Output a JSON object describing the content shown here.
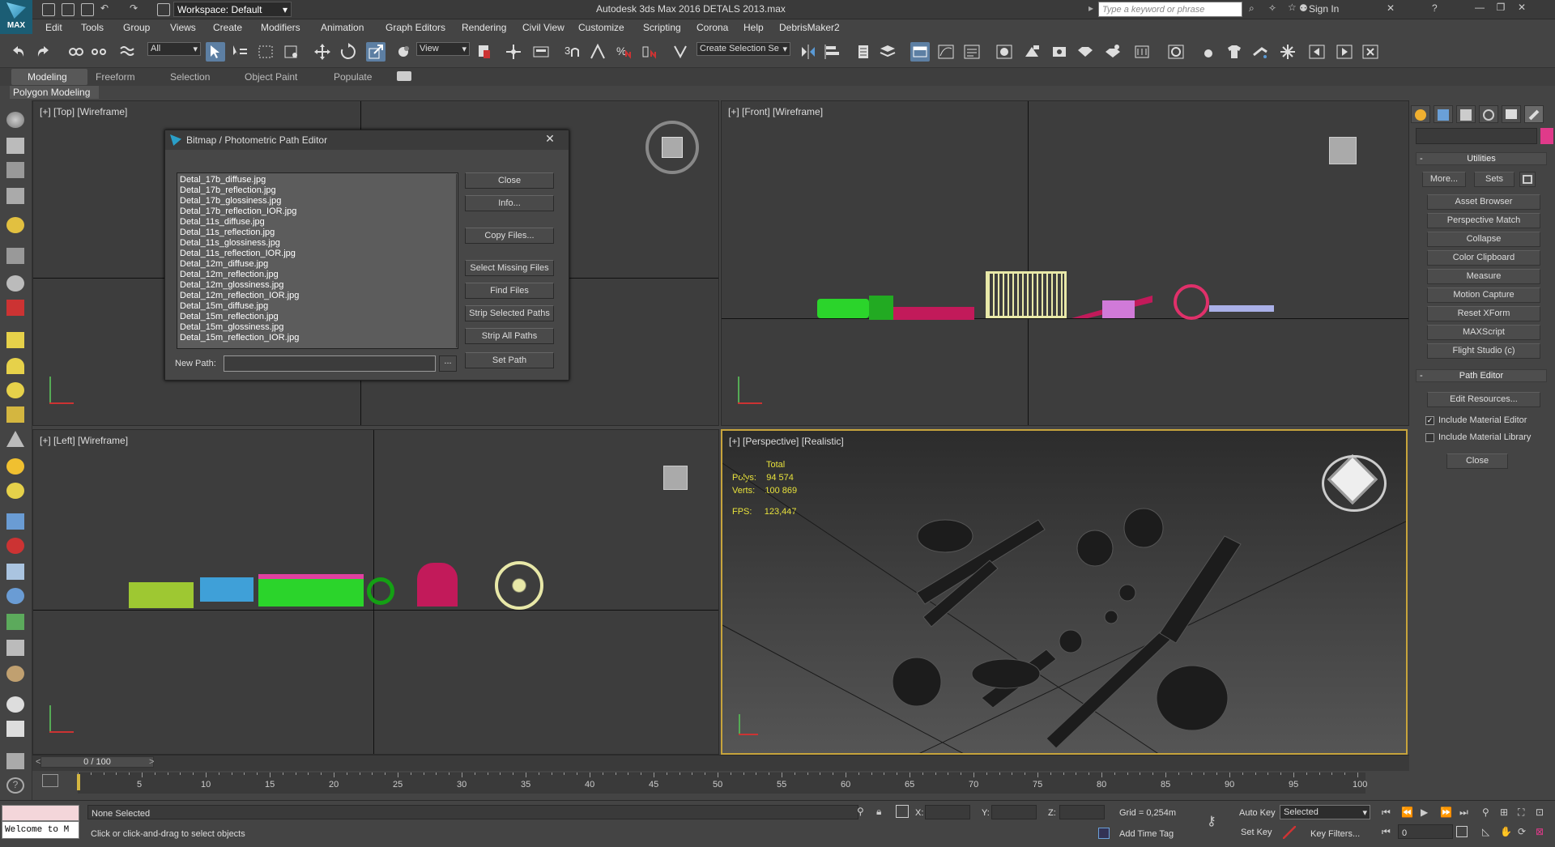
{
  "titlebar": {
    "workspace": "Workspace: Default",
    "app_title": "Autodesk 3ds Max 2016     DETALS 2013.max",
    "search_placeholder": "Type a keyword or phrase",
    "sign_in": "Sign In",
    "logo_text": "MAX"
  },
  "menubar": [
    "Edit",
    "Tools",
    "Group",
    "Views",
    "Create",
    "Modifiers",
    "Animation",
    "Graph Editors",
    "Rendering",
    "Civil View",
    "Customize",
    "Scripting",
    "Corona",
    "Help",
    "DebrisMaker2"
  ],
  "toolbar": {
    "selection_filter": "All",
    "ref_coord": "View",
    "named_sel": "Create Selection Se"
  },
  "ribbon": {
    "tabs": [
      "Modeling",
      "Freeform",
      "Selection",
      "Object Paint",
      "Populate"
    ],
    "sub_label": "Polygon Modeling"
  },
  "viewports": {
    "top": "[+] [Top] [Wireframe]",
    "front": "[+] [Front] [Wireframe]",
    "left": "[+] [Left] [Wireframe]",
    "persp": "[+] [Perspective] [Realistic]"
  },
  "stats": {
    "total_label": "Total",
    "polys_label": "Polys:",
    "polys": "94 574",
    "verts_label": "Verts:",
    "verts": "100 869",
    "fps_label": "FPS:",
    "fps": "123,447"
  },
  "dialog": {
    "title": "Bitmap / Photometric Path Editor",
    "files": [
      "Detal_17b_diffuse.jpg",
      "Detal_17b_reflection.jpg",
      "Detal_17b_glossiness.jpg",
      "Detal_17b_reflection_IOR.jpg",
      "Detal_11s_diffuse.jpg",
      "Detal_11s_reflection.jpg",
      "Detal_11s_glossiness.jpg",
      "Detal_11s_reflection_IOR.jpg",
      "Detal_12m_diffuse.jpg",
      "Detal_12m_reflection.jpg",
      "Detal_12m_glossiness.jpg",
      "Detal_12m_reflection_IOR.jpg",
      "Detal_15m_diffuse.jpg",
      "Detal_15m_reflection.jpg",
      "Detal_15m_glossiness.jpg",
      "Detal_15m_reflection_IOR.jpg"
    ],
    "buttons": {
      "close": "Close",
      "info": "Info...",
      "copy_files": "Copy Files...",
      "select_missing": "Select Missing Files",
      "find_files": "Find Files",
      "strip_selected": "Strip Selected Paths",
      "strip_all": "Strip All Paths",
      "set_path": "Set Path"
    },
    "new_path_label": "New Path:",
    "new_path_value": "",
    "browse": "..."
  },
  "command_panel": {
    "utilities_header": "Utilities",
    "more": "More...",
    "sets": "Sets",
    "utilities": [
      "Asset Browser",
      "Perspective Match",
      "Collapse",
      "Color Clipboard",
      "Measure",
      "Motion Capture",
      "Reset XForm",
      "MAXScript",
      "Flight Studio (c)"
    ],
    "path_editor_header": "Path Editor",
    "edit_resources": "Edit Resources...",
    "include_material_editor": "Include Material Editor",
    "include_material_library": "Include Material Library",
    "include_material_editor_checked": true,
    "include_material_library_checked": false,
    "close": "Close"
  },
  "timeline": {
    "frame": "0 / 100",
    "ticks": [
      "5",
      "10",
      "15",
      "20",
      "25",
      "30",
      "35",
      "40",
      "45",
      "50",
      "55",
      "60",
      "65",
      "70",
      "75",
      "80",
      "85",
      "90",
      "95",
      "100"
    ]
  },
  "status": {
    "none_selected": "None Selected",
    "prompt": "Click or click-and-drag to select objects",
    "welcome": "Welcome to M",
    "x_label": "X:",
    "y_label": "Y:",
    "z_label": "Z:",
    "grid": "Grid = 0,254m",
    "add_time_tag": "Add Time Tag",
    "auto_key": "Auto Key",
    "key_mode": "Selected",
    "set_key": "Set Key",
    "key_filters": "Key Filters...",
    "current_frame": "0"
  }
}
